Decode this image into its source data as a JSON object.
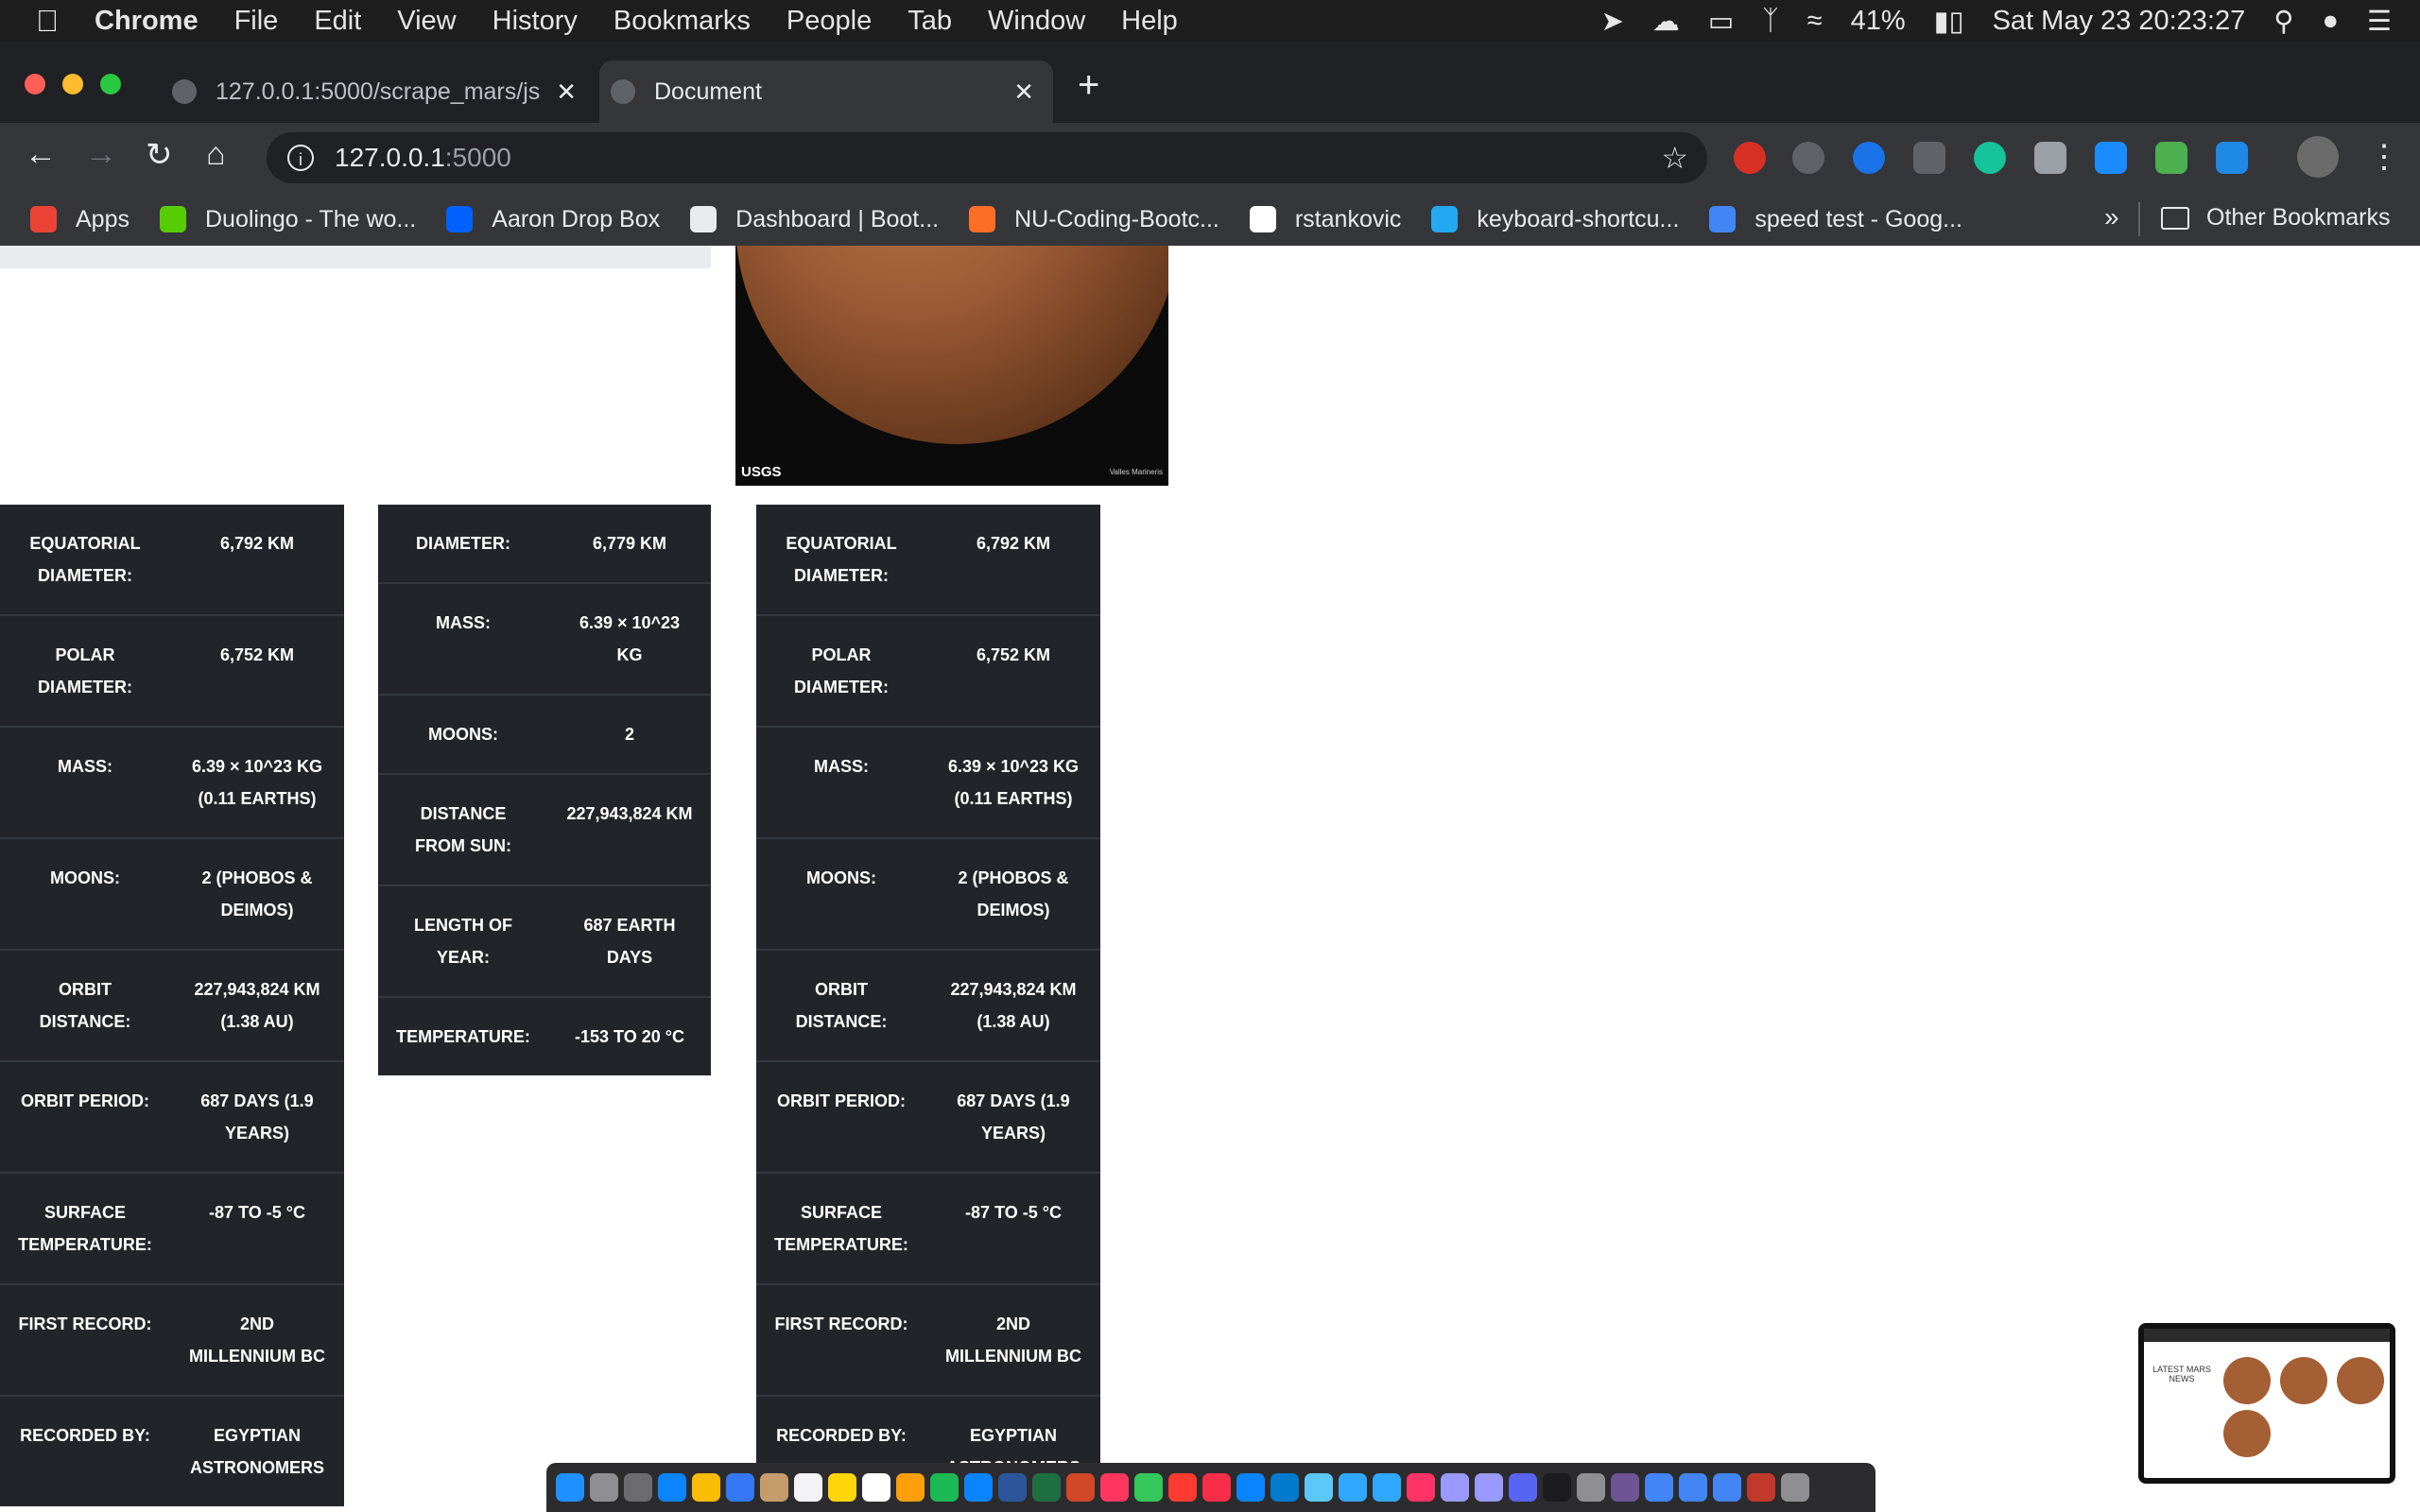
{
  "menubar": {
    "app_name": "Chrome",
    "items": [
      "File",
      "Edit",
      "View",
      "History",
      "Bookmarks",
      "People",
      "Tab",
      "Window",
      "Help"
    ],
    "battery": "41%",
    "datetime": "Sat May 23  20:23:27"
  },
  "tabs": [
    {
      "label": "127.0.0.1:5000/scrape_mars/js"
    },
    {
      "label": "Document"
    }
  ],
  "toolbar": {
    "url_host": "127.0.0.1",
    "url_port": ":5000"
  },
  "bookmarks": {
    "items": [
      {
        "label": "Apps",
        "color": "#ea4335"
      },
      {
        "label": "Duolingo - The wo...",
        "color": "#58cc02"
      },
      {
        "label": "Aaron Drop Box",
        "color": "#0061fe"
      },
      {
        "label": "Dashboard | Boot...",
        "color": "#e8eaed"
      },
      {
        "label": "NU-Coding-Bootc...",
        "color": "#fc6d26"
      },
      {
        "label": "rstankovic",
        "color": "#ffffff"
      },
      {
        "label": "keyboard-shortcu...",
        "color": "#23a9f2"
      },
      {
        "label": "speed test - Goog...",
        "color": "#4285f4"
      }
    ],
    "overflow": "»",
    "other": "Other Bookmarks"
  },
  "image": {
    "logo": "USGS",
    "caption": "Valles Marineris"
  },
  "table1": [
    {
      "label": "Equatorial Diameter:",
      "value": "6,792 km"
    },
    {
      "label": "Polar Diameter:",
      "value": "6,752 km"
    },
    {
      "label": "Mass:",
      "value": "6.39 × 10^23 kg (0.11 Earths)"
    },
    {
      "label": "Moons:",
      "value": "2 (Phobos & Deimos)"
    },
    {
      "label": "Orbit Distance:",
      "value": "227,943,824 km (1.38 AU)"
    },
    {
      "label": "Orbit Period:",
      "value": "687 days (1.9 years)"
    },
    {
      "label": "Surface Temperature:",
      "value": "-87 to -5 °C"
    },
    {
      "label": "First Record:",
      "value": "2nd millennium BC"
    },
    {
      "label": "Recorded By:",
      "value": "Egyptian astronomers"
    }
  ],
  "table2": [
    {
      "label": "Diameter:",
      "value": "6,779 km"
    },
    {
      "label": "Mass:",
      "value": "6.39 × 10^23 kg"
    },
    {
      "label": "Moons:",
      "value": "2"
    },
    {
      "label": "Distance from Sun:",
      "value": "227,943,824 km"
    },
    {
      "label": "Length of Year:",
      "value": "687 Earth days"
    },
    {
      "label": "Temperature:",
      "value": "-153 to 20 °C"
    }
  ],
  "pip": {
    "title": "LATEST MARS NEWS"
  }
}
